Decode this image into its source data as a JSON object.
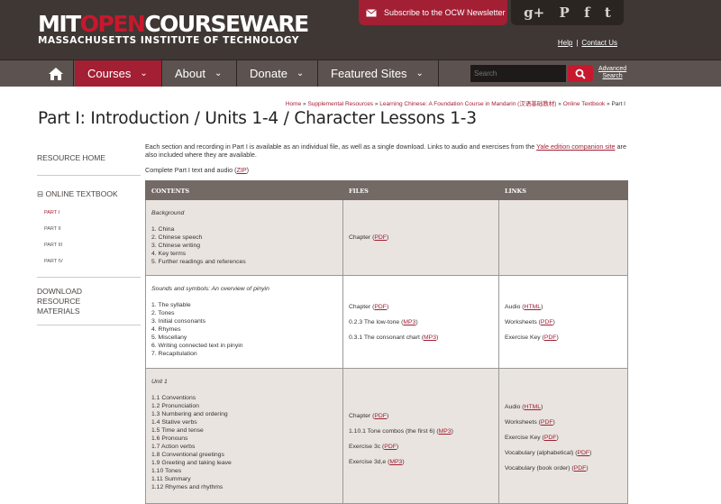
{
  "header": {
    "logo_main_prefix": "MIT",
    "logo_main_red": "OPEN",
    "logo_main_suffix": "COURSEWARE",
    "logo_sub": "MASSACHUSETTS INSTITUTE OF TECHNOLOGY",
    "subscribe_label": "Subscribe to the OCW Newsletter",
    "social": [
      "g+",
      "P",
      "f",
      "t"
    ],
    "help_label": "Help",
    "contact_label": "Contact Us"
  },
  "nav": {
    "items": [
      {
        "label": "Courses",
        "active": true
      },
      {
        "label": "About"
      },
      {
        "label": "Donate"
      },
      {
        "label": "Featured Sites"
      }
    ],
    "search_placeholder": "Search",
    "advanced_line1": "Advanced",
    "advanced_line2": "Search"
  },
  "breadcrumb": {
    "items": [
      "Home",
      "Supplemental Resources",
      "Learning Chinese: A Foundation Course in Mandarin (汉语基础教材)",
      "Online Textbook"
    ],
    "current": "Part I"
  },
  "page_title": "Part I: Introduction / Units 1-4 / Character Lessons 1-3",
  "sidebar": {
    "resource_home": "Resource Home",
    "online_textbook": "Online Textbook",
    "parts": [
      "Part I",
      "Part II",
      "Part III",
      "Part IV"
    ],
    "download_line1": "Download",
    "download_line2": "Resource",
    "download_line3": "Materials"
  },
  "intro": {
    "text": "Each section and recording in Part I is available as an individual file, as well as a single download. Links to audio and exercises from the",
    "link": "Yale edition companion site",
    "text_after": "are also included where they are available."
  },
  "complete": {
    "text": "Complete Part I text and audio (",
    "link": "ZIP",
    "close": ")"
  },
  "table": {
    "headers": [
      "CONTENTS",
      "FILES",
      "LINKS"
    ],
    "rows": [
      {
        "title": "Background",
        "topics": [
          "1. China",
          "2. Chinese speech",
          "3. Chinese writing",
          "4. Key terms",
          "5. Further readings and references"
        ],
        "files": [
          {
            "label": "Chapter",
            "link": "PDF"
          }
        ],
        "links": []
      },
      {
        "title": "Sounds and symbols: An overview of pinyin",
        "topics": [
          "1. The syllable",
          "2. Tones",
          "3. Initial consonants",
          "4. Rhymes",
          "5. Miscellany",
          "6. Writing connected text in pinyin",
          "7. Recapitulation"
        ],
        "files": [
          {
            "label": "Chapter",
            "link": "PDF"
          },
          {
            "label": "0.2.3 The low-tone",
            "link": "MP3"
          },
          {
            "label": "0.3.1 The consonant chart",
            "link": "MP3"
          }
        ],
        "links": [
          {
            "label": "Audio",
            "link": "HTML"
          },
          {
            "label": "Worksheets",
            "link": "PDF"
          },
          {
            "label": "Exercise Key",
            "link": "PDF"
          }
        ]
      },
      {
        "title": "Unit 1",
        "topics": [
          "1.1 Conventions",
          "1.2 Pronunciation",
          "1.3 Numbering and ordering",
          "1.4 Stative verbs",
          "1.5 Time and tense",
          "1.6 Pronouns",
          "1.7 Action verbs",
          "1.8 Conventional greetings",
          "1.9 Greeting and taking leave",
          "1.10 Tones",
          "1.11 Summary",
          "1.12 Rhymes and rhythms"
        ],
        "files": [
          {
            "label": "Chapter",
            "link": "PDF"
          },
          {
            "label": "1.10.1 Tone combos (the first 6)",
            "link": "MP3"
          },
          {
            "label": "Exercise 3c",
            "link": "PDF"
          },
          {
            "label": "Exercise 3d,e",
            "link": "MP3"
          }
        ],
        "links": [
          {
            "label": "Audio",
            "link": "HTML"
          },
          {
            "label": "Worksheets",
            "link": "PDF"
          },
          {
            "label": "Exercise Key",
            "link": "PDF"
          },
          {
            "label": "Vocabulary (alphabetical)",
            "link": "PDF"
          },
          {
            "label": "Vocabulary (book order)",
            "link": "PDF"
          }
        ]
      }
    ]
  }
}
